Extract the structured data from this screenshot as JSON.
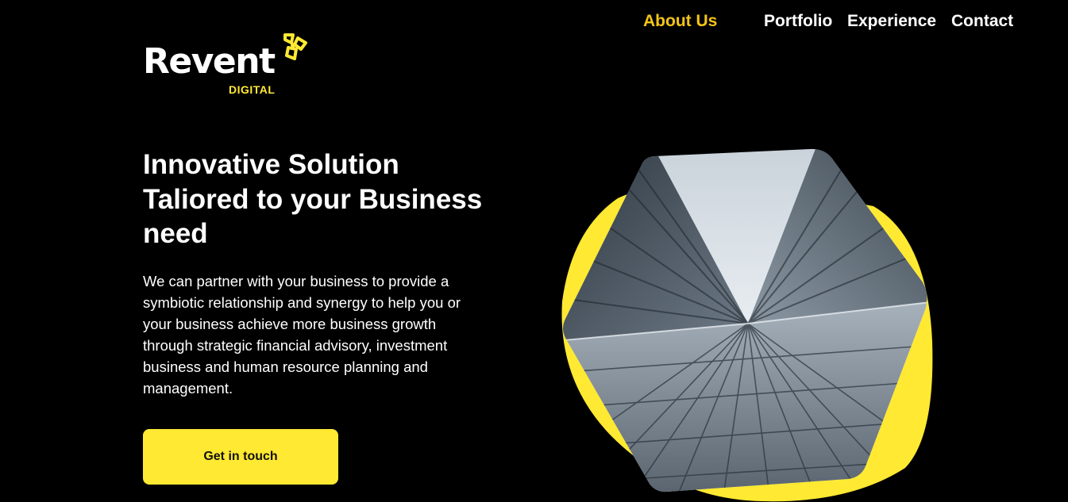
{
  "brand": {
    "name": "Revent",
    "tagline": "DIGITAL",
    "logo_icon": "trefoil-mark-icon",
    "accent_color": "#ffe932"
  },
  "nav": {
    "items": [
      {
        "label": "About Us",
        "active": true
      },
      {
        "label": "Portfolio",
        "active": false
      },
      {
        "label": "Experience",
        "active": false
      },
      {
        "label": "Contact",
        "active": false
      }
    ],
    "active_color": "#f5c518"
  },
  "hero": {
    "title_lines": [
      "Innovative Solution",
      "Taliored to your Business",
      "need"
    ],
    "description_lines": [
      "We can partner with your business to provide a",
      "symbiotic relationship and synergy to help you or",
      "your business achieve more business growth",
      "through strategic financial advisory, investment",
      "business and human resource planning and",
      "management."
    ],
    "cta_label": "Get in touch",
    "image": "skyscraper-looking-up-image"
  },
  "colors": {
    "background": "#000000",
    "text": "#ffffff",
    "button_bg": "#ffe932",
    "button_text": "#111111"
  }
}
